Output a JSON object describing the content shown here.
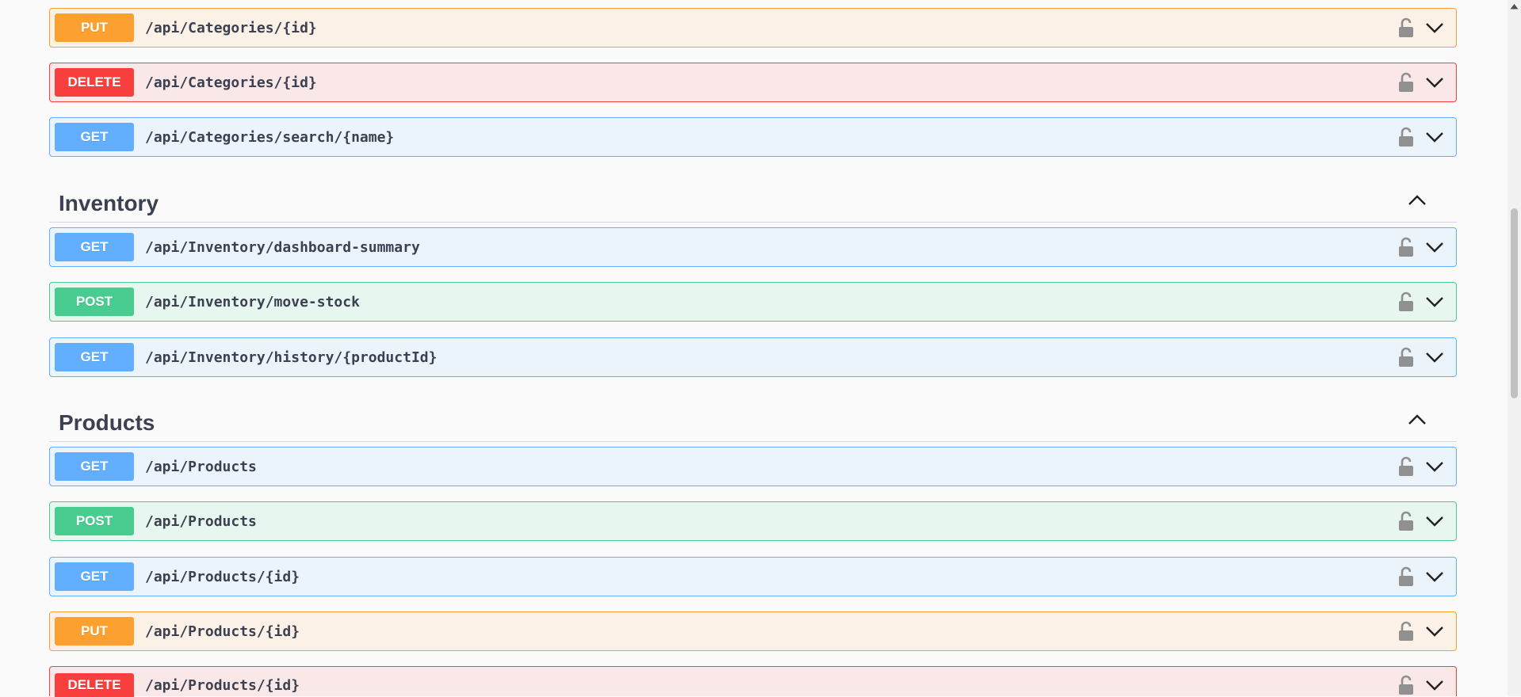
{
  "sections": [
    {
      "title": "Inventory",
      "toggle_icon": "chevron-up-icon"
    },
    {
      "title": "Products",
      "toggle_icon": "chevron-up-icon"
    }
  ],
  "operations": [
    {
      "method": "PUT",
      "path": "/api/Categories/{id}"
    },
    {
      "method": "DELETE",
      "path": "/api/Categories/{id}"
    },
    {
      "method": "GET",
      "path": "/api/Categories/search/{name}"
    },
    {
      "method": "GET",
      "path": "/api/Inventory/dashboard-summary"
    },
    {
      "method": "POST",
      "path": "/api/Inventory/move-stock"
    },
    {
      "method": "GET",
      "path": "/api/Inventory/history/{productId}"
    },
    {
      "method": "GET",
      "path": "/api/Products"
    },
    {
      "method": "POST",
      "path": "/api/Products"
    },
    {
      "method": "GET",
      "path": "/api/Products/{id}"
    },
    {
      "method": "PUT",
      "path": "/api/Products/{id}"
    },
    {
      "method": "DELETE",
      "path": "/api/Products/{id}"
    }
  ],
  "icons": {
    "lock": "unlock-icon",
    "expand": "chevron-down-icon"
  },
  "colors": {
    "get": "#61affe",
    "post": "#49cc90",
    "put": "#fca130",
    "delete": "#f93e3e",
    "text": "#3b4151",
    "background": "#fafafa"
  }
}
